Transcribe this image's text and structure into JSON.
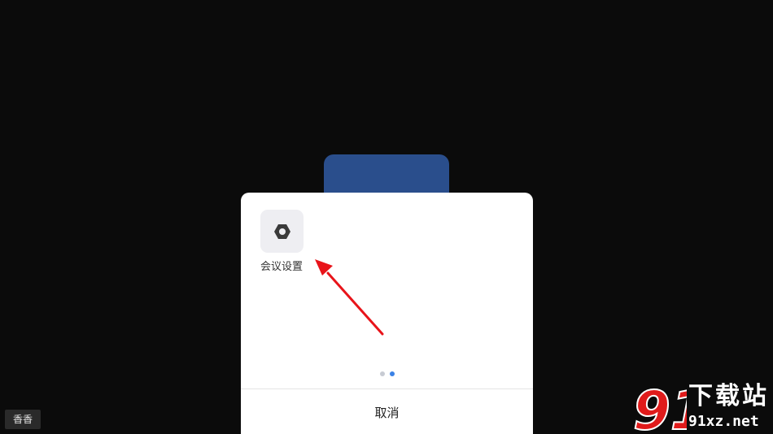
{
  "sheet": {
    "actions": [
      {
        "label": "会议设置",
        "icon": "settings-hexagon-icon"
      }
    ],
    "pager": {
      "total": 2,
      "active": 2
    },
    "cancel_label": "取消"
  },
  "participant": {
    "name": "香香"
  },
  "watermark": {
    "title": "下载站",
    "url": "91xz.net",
    "logo_text": "91"
  },
  "colors": {
    "background": "#0b0b0b",
    "avatar_card": "#2a4e8c",
    "pager_active": "#3b82e6",
    "pager_inactive": "#c7cbd3",
    "annotation_arrow": "#e8141a"
  }
}
